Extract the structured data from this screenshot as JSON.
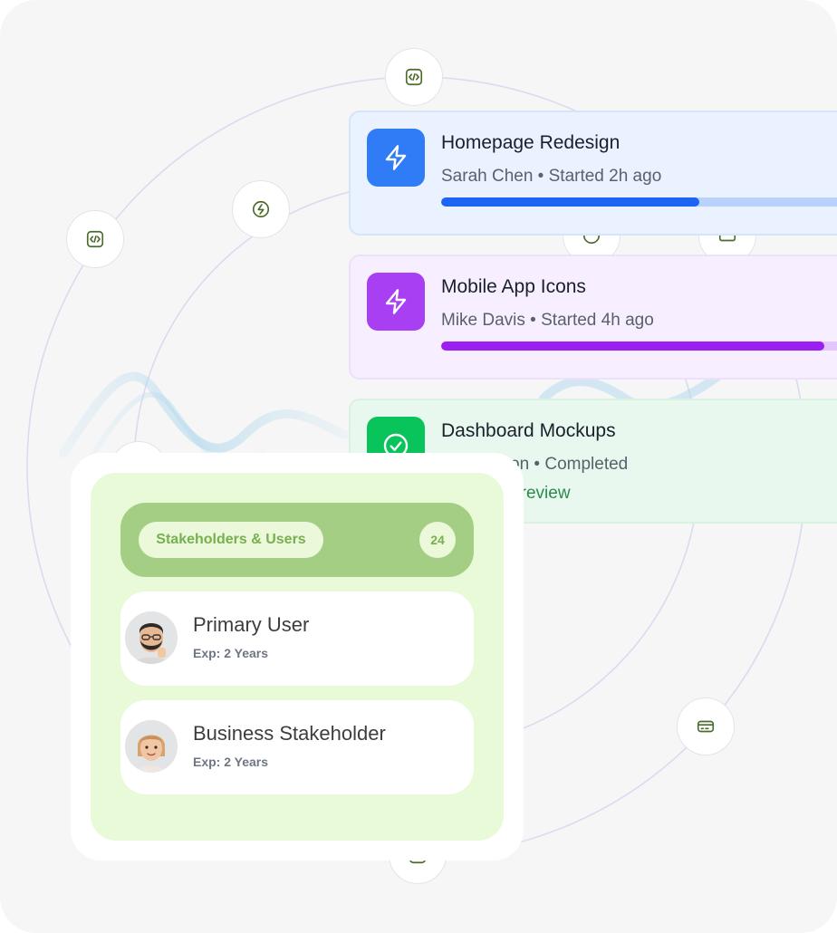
{
  "colors": {
    "background": "#f6f6f7",
    "orbit": "#d8dcef",
    "icon_green": "#4a6b2a",
    "blue": "#1d64f2",
    "purple": "#9b1ff0",
    "green": "#09c35b",
    "panel_green": "#a3ce83"
  },
  "tasks": [
    {
      "title": "Homepage Redesign",
      "subtitle": "Sarah Chen • Started 2h ago",
      "icon": "bolt-icon",
      "progress": 0.62
    },
    {
      "title": "Mobile App Icons",
      "subtitle": "Mike Davis • Started 4h ago",
      "icon": "bolt-icon",
      "progress": 0.92
    },
    {
      "title": "Dashboard Mockups",
      "subtitle": "Lisa Wilson • Completed",
      "note": "Ready for review",
      "icon": "check-circle-icon"
    }
  ],
  "stakeholders": {
    "label": "Stakeholders & Users",
    "count": "24",
    "people": [
      {
        "name": "Primary User",
        "exp": "Exp: 2 Years",
        "avatar": "avatar-bearded-man"
      },
      {
        "name": "Business Stakeholder",
        "exp": "Exp: 2 Years",
        "avatar": "avatar-blonde-woman"
      }
    ]
  },
  "orbit_icons": [
    "code-icon",
    "code-icon",
    "bolt-circle-icon",
    "credit-card-icon"
  ]
}
